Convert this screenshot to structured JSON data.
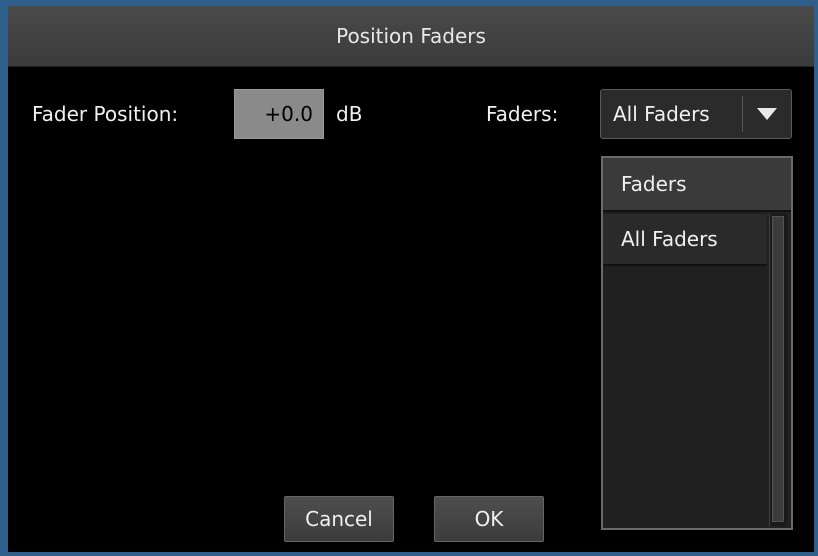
{
  "dialog": {
    "title": "Position Faders"
  },
  "fader_position": {
    "label": "Fader Position:",
    "value": "+0.0",
    "unit": "dB"
  },
  "faders": {
    "label": "Faders:",
    "selected": "All Faders",
    "dropdown_icon": "triangle-down-icon"
  },
  "list": {
    "header": "Faders",
    "items": [
      {
        "label": "All Faders"
      }
    ]
  },
  "buttons": {
    "cancel": "Cancel",
    "ok": "OK"
  }
}
